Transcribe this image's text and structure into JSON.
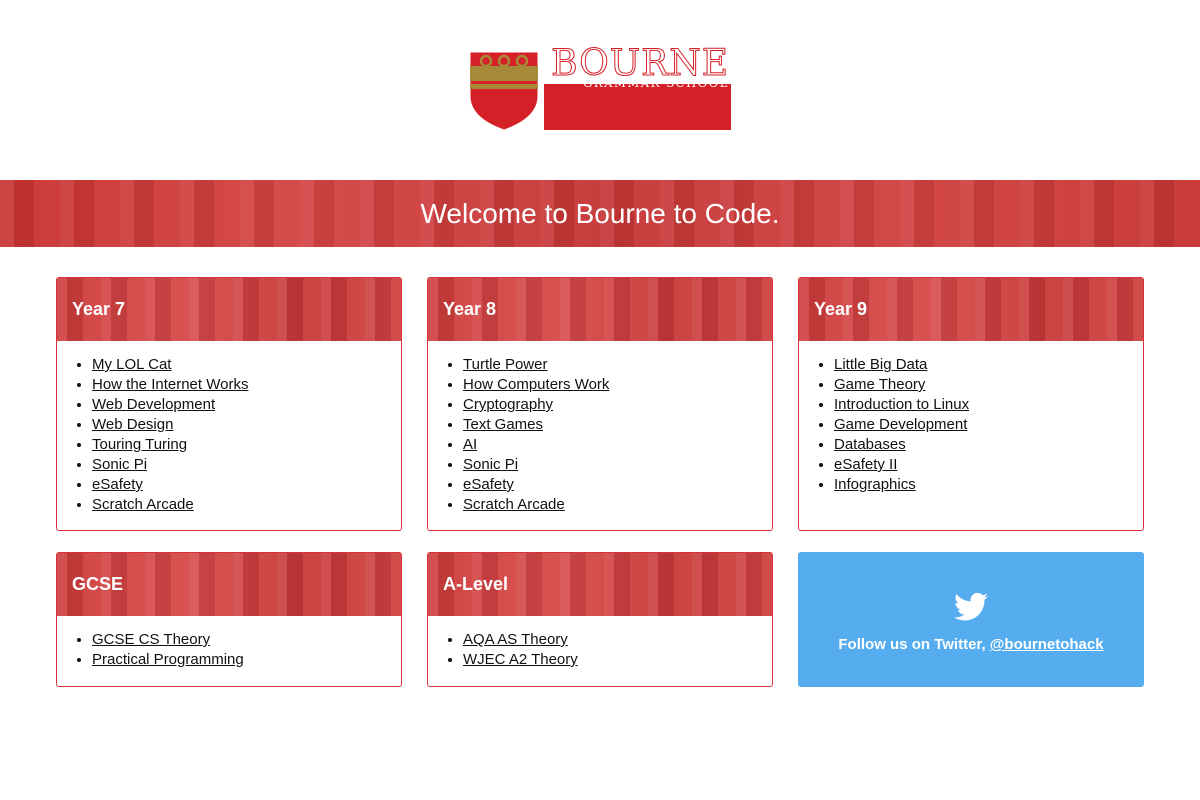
{
  "logo": {
    "wordmark": "BOURNE",
    "subtitle": "GRAMMAR SCHOOL",
    "colors": {
      "red": "#d52027",
      "gold": "#a58a3a"
    }
  },
  "banner": {
    "title": "Welcome to Bourne to Code."
  },
  "cards": [
    {
      "title": "Year 7",
      "links": [
        "My LOL Cat",
        "How the Internet Works",
        "Web Development",
        "Web Design",
        "Touring Turing",
        "Sonic Pi",
        "eSafety",
        "Scratch Arcade"
      ]
    },
    {
      "title": "Year 8",
      "links": [
        "Turtle Power",
        "How Computers Work",
        "Cryptography",
        "Text Games",
        "AI",
        "Sonic Pi",
        "eSafety",
        "Scratch Arcade"
      ]
    },
    {
      "title": "Year 9",
      "links": [
        "Little Big Data",
        "Game Theory",
        "Introduction to Linux",
        "Game Development",
        "Databases",
        "eSafety II",
        "Infographics"
      ]
    },
    {
      "title": "GCSE",
      "links": [
        "GCSE CS Theory",
        "Practical Programming"
      ]
    },
    {
      "title": "A-Level",
      "links": [
        "AQA AS Theory",
        "WJEC A2 Theory"
      ]
    }
  ],
  "twitter": {
    "icon": "twitter-bird-icon",
    "text": "Follow us on Twitter,",
    "handle": "@bournetohack",
    "color": "#55acee"
  }
}
